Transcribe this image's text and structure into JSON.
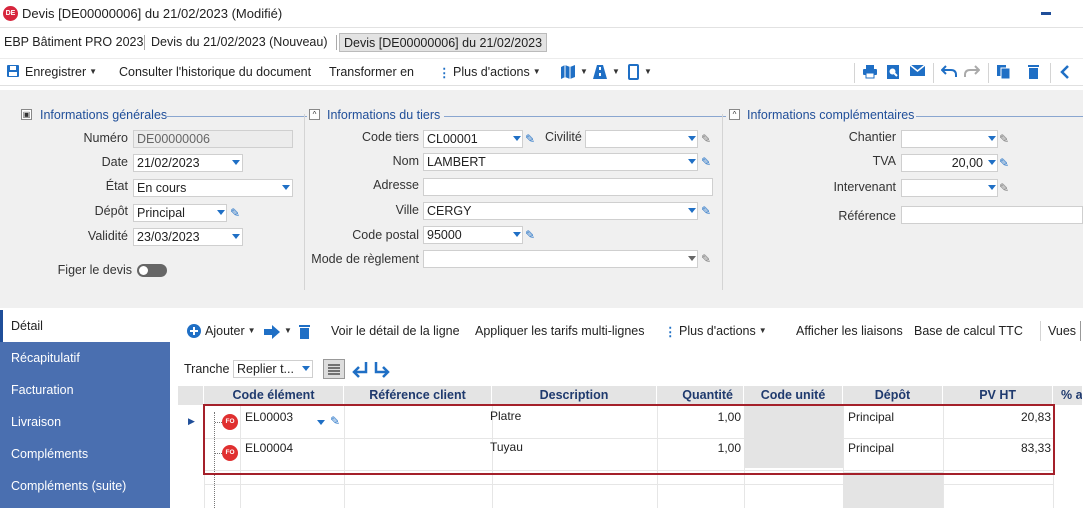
{
  "window": {
    "badge": "DE",
    "title": "Devis [DE00000006] du 21/02/2023 (Modifié)"
  },
  "breadcrumbs": [
    "EBP Bâtiment PRO 2023",
    "Devis du 21/02/2023 (Nouveau)",
    "Devis [DE00000006] du 21/02/2023"
  ],
  "toolbar": {
    "save": "Enregistrer",
    "history": "Consulter l'historique du document",
    "transform": "Transformer en",
    "more_actions": "Plus d'actions"
  },
  "general": {
    "title": "Informations générales",
    "numero_label": "Numéro",
    "numero_value": "DE00000006",
    "date_label": "Date",
    "date_value": "21/02/2023",
    "etat_label": "État",
    "etat_value": "En cours",
    "depot_label": "Dépôt",
    "depot_value": "Principal",
    "validite_label": "Validité",
    "validite_value": "23/03/2023",
    "figer_label": "Figer le devis"
  },
  "tiers": {
    "title": "Informations du tiers",
    "code_label": "Code tiers",
    "code_value": "CL00001",
    "civilite_label": "Civilité",
    "civilite_value": "",
    "nom_label": "Nom",
    "nom_value": "LAMBERT",
    "adresse_label": "Adresse",
    "adresse_value": "",
    "ville_label": "Ville",
    "ville_value": "CERGY",
    "cp_label": "Code postal",
    "cp_value": "95000",
    "reglement_label": "Mode de règlement",
    "reglement_value": ""
  },
  "complementaires": {
    "title": "Informations complémentaires",
    "chantier_label": "Chantier",
    "chantier_value": "",
    "tva_label": "TVA",
    "tva_value": "20,00",
    "intervenant_label": "Intervenant",
    "intervenant_value": "",
    "reference_label": "Référence",
    "reference_value": ""
  },
  "sidebar": {
    "items": [
      "Détail",
      "Récapitulatif",
      "Facturation",
      "Livraison",
      "Compléments",
      "Compléments (suite)"
    ]
  },
  "detail_toolbar": {
    "add": "Ajouter",
    "view_detail": "Voir le détail de la ligne",
    "apply_rates": "Appliquer les tarifs multi-lignes",
    "more_actions": "Plus d'actions",
    "show_links": "Afficher les liaisons",
    "calc_base": "Base de calcul TTC",
    "views": "Vues",
    "tranche_label": "Tranche",
    "tranche_value": "Replier t..."
  },
  "grid": {
    "columns": [
      "Code élément",
      "Référence client",
      "Description",
      "Quantité",
      "Code unité",
      "Dépôt",
      "PV HT",
      "% a"
    ],
    "rows": [
      {
        "badge": "FO",
        "code": "EL00003",
        "ref": "",
        "description": "Platre",
        "quantite": "1,00",
        "unite": "",
        "depot": "Principal",
        "pvht": "20,83"
      },
      {
        "badge": "FO",
        "code": "EL00004",
        "ref": "",
        "description": "Tuyau",
        "quantite": "1,00",
        "unite": "",
        "depot": "Principal",
        "pvht": "83,33"
      }
    ]
  },
  "colors": {
    "accent": "#1f6fc5",
    "sidebar": "#4a6fb0",
    "highlight_border": "#a4202a",
    "badge": "#e03030"
  }
}
